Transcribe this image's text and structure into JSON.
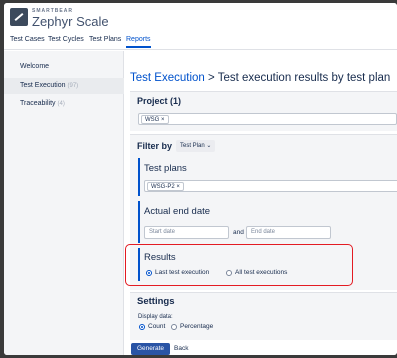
{
  "app": {
    "brand_small": "SMARTBEAR",
    "brand": "Zephyr Scale"
  },
  "tabs": [
    {
      "label": "Test Cases"
    },
    {
      "label": "Test Cycles"
    },
    {
      "label": "Test Plans"
    },
    {
      "label": "Reports",
      "active": true
    }
  ],
  "sidebar": {
    "items": [
      {
        "label": "Welcome",
        "count": ""
      },
      {
        "label": "Test Execution",
        "count": "(97)"
      },
      {
        "label": "Traceability",
        "count": "(4)"
      }
    ]
  },
  "page": {
    "title_link": "Test Execution",
    "title_sep": " > ",
    "title_rest": "Test execution results by test plan"
  },
  "project": {
    "heading": "Project (1)",
    "chip": "WSG",
    "chip_remove": "×"
  },
  "filter": {
    "label": "Filter by",
    "select_value": "Test Plan",
    "select_caret": "⌄"
  },
  "test_plans": {
    "heading": "Test plans",
    "chip": "WSG-P2",
    "chip_remove": "×"
  },
  "end_date": {
    "heading": "Actual end date",
    "start_placeholder": "Start date",
    "and": "and",
    "end_placeholder": "End date"
  },
  "results": {
    "heading": "Results",
    "options": [
      {
        "label": "Last test execution",
        "selected": true
      },
      {
        "label": "All test executions",
        "selected": false
      }
    ]
  },
  "settings": {
    "heading": "Settings",
    "display_label": "Display data:",
    "options": [
      {
        "label": "Count",
        "selected": true
      },
      {
        "label": "Percentage",
        "selected": false
      }
    ]
  },
  "actions": {
    "generate": "Generate",
    "back": "Back"
  },
  "colors": {
    "accent": "#0052cc",
    "highlight": "#e31b23",
    "primary_button": "#2a54a5"
  }
}
